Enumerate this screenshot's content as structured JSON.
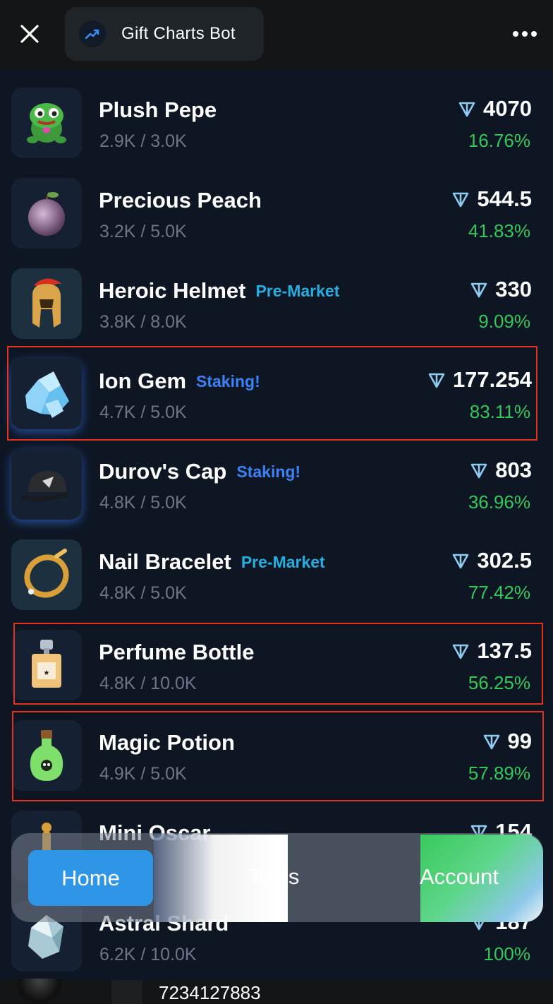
{
  "header": {
    "title": "Gift Charts Bot",
    "close_icon": "close-icon",
    "more_icon": "more-icon",
    "bot_icon": "trend-up-icon"
  },
  "gifts": [
    {
      "name": "Plush Pepe",
      "tag": "",
      "supply": "2.9K / 3.0K",
      "price": "4070",
      "change": "16.76%",
      "icon": "frog-plush-icon",
      "highlighted": false
    },
    {
      "name": "Precious Peach",
      "tag": "",
      "supply": "3.2K / 5.0K",
      "price": "544.5",
      "change": "41.83%",
      "icon": "peach-icon",
      "highlighted": false
    },
    {
      "name": "Heroic Helmet",
      "tag": "Pre-Market",
      "supply": "3.8K / 8.0K",
      "price": "330",
      "change": "9.09%",
      "icon": "spartan-helmet-icon",
      "highlighted": false
    },
    {
      "name": "Ion Gem",
      "tag": "Staking!",
      "supply": "4.7K / 5.0K",
      "price": "177.254",
      "change": "83.11%",
      "icon": "crystal-gem-icon",
      "highlighted": true
    },
    {
      "name": "Durov's Cap",
      "tag": "Staking!",
      "supply": "4.8K / 5.0K",
      "price": "803",
      "change": "36.96%",
      "icon": "cap-icon",
      "highlighted": false
    },
    {
      "name": "Nail Bracelet",
      "tag": "Pre-Market",
      "supply": "4.8K / 5.0K",
      "price": "302.5",
      "change": "77.42%",
      "icon": "bracelet-icon",
      "highlighted": false
    },
    {
      "name": "Perfume Bottle",
      "tag": "",
      "supply": "4.8K / 10.0K",
      "price": "137.5",
      "change": "56.25%",
      "icon": "perfume-icon",
      "highlighted": true
    },
    {
      "name": "Magic Potion",
      "tag": "",
      "supply": "4.9K / 5.0K",
      "price": "99",
      "change": "57.89%",
      "icon": "potion-icon",
      "highlighted": true
    },
    {
      "name": "Mini Oscar",
      "tag": "",
      "supply": "",
      "price": "154",
      "change": "",
      "icon": "oscar-icon",
      "highlighted": false
    },
    {
      "name": "Astral Shard",
      "tag": "",
      "supply": "6.2K / 10.0K",
      "price": "187",
      "change": "100%",
      "icon": "shard-icon",
      "highlighted": false
    }
  ],
  "currency_icon": "ton-icon",
  "nav": {
    "home": "Home",
    "tools": "Tools",
    "account": "Account"
  },
  "footer": {
    "user_id": "7234127883"
  },
  "colors": {
    "background": "#0e1624",
    "positive": "#34c759",
    "pre_market": "#27aee0",
    "staking": "#3b82f6",
    "highlight": "#e5321f",
    "nav_active": "#2f95e6"
  }
}
